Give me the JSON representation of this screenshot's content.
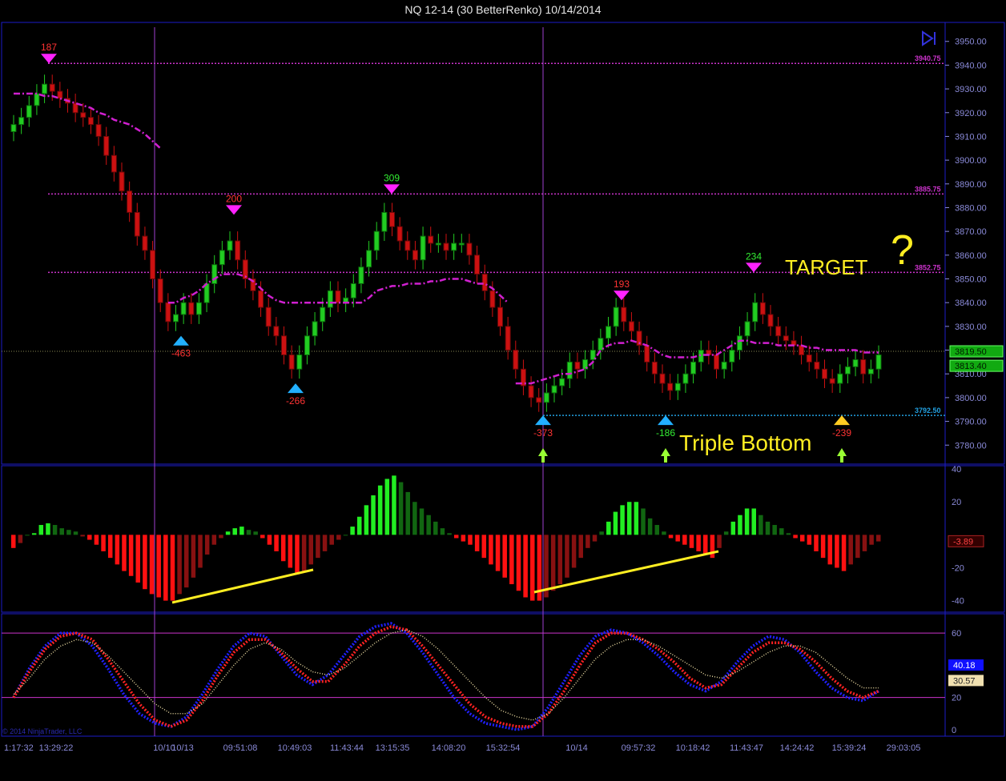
{
  "window": {
    "title": "NQ 12-14 (30 BetterRenko)  10/14/2014",
    "copyright": "© 2014 NinjaTrader, LLC"
  },
  "colors": {
    "background": "#000000",
    "frame": "#1c1cc8",
    "axis_text": "#8a8ad8",
    "up_candle": "#22cc22",
    "down_candle": "#cc1111",
    "level_line": "#cc33cc",
    "support_line": "#22a0e0",
    "annotation": "#ffee22",
    "swing_label_up": "#33ee33",
    "swing_label_down": "#ff3333",
    "trend_line": "#ffee22"
  },
  "chart_data": [
    {
      "type": "candlestick",
      "name": "price",
      "ylim": [
        3772,
        3958
      ],
      "yticks": [
        3780,
        3790,
        3800,
        3810,
        3820,
        3830,
        3840,
        3850,
        3860,
        3870,
        3880,
        3890,
        3900,
        3910,
        3920,
        3930,
        3940,
        3950
      ],
      "xtick_labels": [
        "1:17:32",
        "13:29:22",
        "10/10",
        "10/13",
        "09:51:08",
        "10:49:03",
        "11:43:44",
        "13:15:35",
        "14:08:20",
        "15:32:54",
        "10/14",
        "09:57:32",
        "10:18:42",
        "11:43:47",
        "14:24:42",
        "15:39:24",
        "29:03:05"
      ],
      "levels": [
        {
          "value": 3940.75,
          "label": "3940.75",
          "color": "#cc33cc",
          "style": "dotted"
        },
        {
          "value": 3885.75,
          "label": "3885.75",
          "color": "#cc33cc",
          "style": "dotted"
        },
        {
          "value": 3852.75,
          "label": "3852.75",
          "color": "#cc33cc",
          "style": "dotted"
        },
        {
          "value": 3792.5,
          "label": "3792.50",
          "color": "#22a0e0",
          "style": "dotted"
        }
      ],
      "price_markers": [
        {
          "value": 3819.5,
          "label": "3819.50"
        },
        {
          "value": 3813.4,
          "label": "3813.40"
        }
      ],
      "swing_labels": [
        {
          "text": "187",
          "price": 3940.75,
          "kind": "high"
        },
        {
          "text": "-463",
          "price": 3826,
          "kind": "low"
        },
        {
          "text": "200",
          "price": 3877,
          "kind": "high"
        },
        {
          "text": "-266",
          "price": 3806,
          "kind": "low"
        },
        {
          "text": "309",
          "price": 3885.75,
          "kind": "high"
        },
        {
          "text": "-373",
          "price": 3792.5,
          "kind": "low"
        },
        {
          "text": "193",
          "price": 3841,
          "kind": "high"
        },
        {
          "text": "-186",
          "price": 3792.5,
          "kind": "low"
        },
        {
          "text": "234",
          "price": 3852.75,
          "kind": "high"
        },
        {
          "text": "-239",
          "price": 3792.5,
          "kind": "low"
        }
      ],
      "annotations": [
        {
          "text": "TARGET",
          "color": "#ffee22"
        },
        {
          "text": "?",
          "color": "#ffee22"
        },
        {
          "text": "Triple Bottom",
          "color": "#ffee22"
        }
      ],
      "series": [
        {
          "name": "close",
          "values": [
            3915,
            3918,
            3923,
            3928,
            3932,
            3929,
            3926,
            3924,
            3920,
            3918,
            3915,
            3910,
            3902,
            3895,
            3887,
            3878,
            3868,
            3862,
            3850,
            3840,
            3832,
            3835,
            3840,
            3835,
            3840,
            3848,
            3856,
            3862,
            3866,
            3858,
            3850,
            3845,
            3838,
            3830,
            3826,
            3818,
            3812,
            3818,
            3826,
            3832,
            3838,
            3845,
            3840,
            3842,
            3848,
            3855,
            3862,
            3870,
            3878,
            3872,
            3866,
            3862,
            3858,
            3868,
            3865,
            3865,
            3862,
            3865,
            3865,
            3860,
            3852,
            3845,
            3838,
            3830,
            3820,
            3812,
            3805,
            3800,
            3798,
            3802,
            3805,
            3808,
            3815,
            3812,
            3816,
            3820,
            3825,
            3830,
            3838,
            3832,
            3828,
            3822,
            3815,
            3810,
            3806,
            3803,
            3806,
            3810,
            3815,
            3820,
            3818,
            3812,
            3815,
            3820,
            3826,
            3832,
            3840,
            3835,
            3830,
            3826,
            3824,
            3822,
            3818,
            3815,
            3812,
            3808,
            3806,
            3810,
            3813,
            3816,
            3810,
            3812,
            3818
          ]
        },
        {
          "name": "moving_average",
          "values": [
            3928,
            3928,
            3928,
            3928,
            3927,
            3927,
            3926,
            3925,
            3924,
            3923,
            3922,
            3920,
            3919,
            3917,
            3916,
            3915,
            3913,
            3911,
            3908,
            3905,
            3840,
            3840,
            3842,
            3843,
            3845,
            3848,
            3850,
            3852,
            3852,
            3852,
            3851,
            3849,
            3846,
            3843,
            3841,
            3840,
            3840,
            3840,
            3840,
            3840,
            3840,
            3840,
            3840,
            3840,
            3840,
            3840,
            3842,
            3845,
            3846,
            3847,
            3847,
            3848,
            3848,
            3848,
            3849,
            3849,
            3850,
            3850,
            3850,
            3849,
            3848,
            3848,
            3846,
            3843,
            3840,
            3806,
            3806,
            3806,
            3807,
            3808,
            3809,
            3810,
            3810,
            3811,
            3812,
            3815,
            3820,
            3822,
            3823,
            3823,
            3824,
            3823,
            3822,
            3820,
            3818,
            3817,
            3817,
            3817,
            3817,
            3818,
            3818,
            3818,
            3820,
            3822,
            3824,
            3824,
            3823,
            3823,
            3823,
            3822,
            3822,
            3822,
            3822,
            3821,
            3821,
            3820,
            3820,
            3820,
            3820,
            3820,
            3819,
            3819,
            3819
          ]
        }
      ]
    },
    {
      "type": "bar",
      "name": "momentum histogram",
      "ylim": [
        -47,
        42
      ],
      "yticks": [
        -40,
        -20,
        20,
        40
      ],
      "last_value_label": "-3.89",
      "values": [
        -8,
        -5,
        0,
        1,
        6,
        7,
        6,
        4,
        3,
        2,
        -1,
        -3,
        -6,
        -10,
        -14,
        -18,
        -22,
        -25,
        -29,
        -33,
        -36,
        -38,
        -40,
        -40,
        -36,
        -32,
        -26,
        -20,
        -12,
        -6,
        -2,
        2,
        4,
        5,
        3,
        2,
        -2,
        -6,
        -10,
        -16,
        -20,
        -24,
        -22,
        -18,
        -14,
        -10,
        -6,
        -3,
        0,
        5,
        11,
        18,
        24,
        30,
        34,
        36,
        32,
        26,
        20,
        16,
        12,
        8,
        4,
        1,
        -2,
        -4,
        -6,
        -10,
        -14,
        -18,
        -22,
        -26,
        -30,
        -34,
        -38,
        -40,
        -40,
        -38,
        -34,
        -30,
        -26,
        -20,
        -14,
        -8,
        -4,
        2,
        8,
        14,
        18,
        20,
        20,
        16,
        10,
        6,
        2,
        -2,
        -4,
        -6,
        -8,
        -10,
        -12,
        -14,
        -8,
        2,
        8,
        12,
        16,
        16,
        12,
        8,
        6,
        4,
        1,
        -2,
        -4,
        -6,
        -10,
        -14,
        -18,
        -20,
        -22,
        -18,
        -14,
        -10,
        -6,
        -4
      ]
    },
    {
      "type": "line",
      "name": "oscillator",
      "ylim": [
        -4,
        72
      ],
      "yticks": [
        0,
        20,
        40,
        60
      ],
      "hlines": [
        20,
        60
      ],
      "value_labels": [
        "40.18",
        "30.57"
      ],
      "series": [
        {
          "name": "fast",
          "color": "#2020ff",
          "values": [
            20,
            38,
            52,
            60,
            60,
            52,
            38,
            22,
            10,
            4,
            2,
            8,
            22,
            38,
            52,
            60,
            58,
            46,
            34,
            28,
            34,
            46,
            58,
            64,
            66,
            60,
            48,
            34,
            20,
            10,
            4,
            2,
            0,
            2,
            14,
            30,
            46,
            58,
            62,
            60,
            54,
            46,
            36,
            28,
            24,
            30,
            42,
            52,
            58,
            56,
            48,
            36,
            26,
            20,
            18,
            24
          ]
        },
        {
          "name": "slow",
          "color": "#ff2222",
          "values": [
            20,
            36,
            50,
            58,
            60,
            56,
            44,
            30,
            16,
            6,
            2,
            6,
            18,
            34,
            48,
            56,
            56,
            48,
            38,
            30,
            30,
            40,
            52,
            60,
            64,
            62,
            52,
            40,
            28,
            16,
            8,
            4,
            2,
            2,
            10,
            24,
            40,
            54,
            60,
            60,
            56,
            50,
            42,
            32,
            26,
            28,
            38,
            48,
            54,
            54,
            50,
            42,
            32,
            24,
            20,
            24
          ]
        },
        {
          "name": "signal",
          "color": "#e8d8a0",
          "values": [
            22,
            32,
            44,
            52,
            56,
            54,
            46,
            36,
            26,
            16,
            10,
            10,
            16,
            28,
            40,
            50,
            54,
            50,
            42,
            36,
            34,
            38,
            46,
            54,
            60,
            62,
            58,
            50,
            40,
            30,
            20,
            12,
            8,
            6,
            10,
            20,
            32,
            44,
            52,
            56,
            56,
            52,
            46,
            40,
            34,
            32,
            36,
            42,
            48,
            52,
            52,
            48,
            40,
            32,
            26,
            26
          ]
        }
      ]
    }
  ]
}
